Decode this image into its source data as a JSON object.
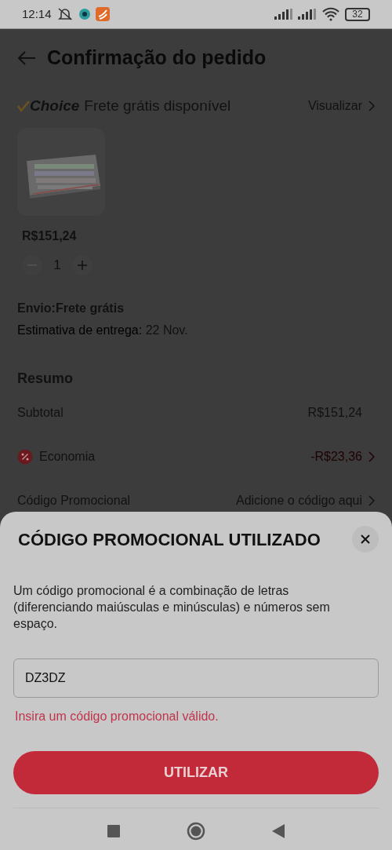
{
  "status_bar": {
    "time": "12:14",
    "battery": "32"
  },
  "header": {
    "title": "Confirmação do pedido"
  },
  "shipping_banner": {
    "brand": "Choice",
    "text": "Frete grátis disponível",
    "link": "Visualizar"
  },
  "product": {
    "price": "R$151,24",
    "quantity": "1",
    "decrease_disabled": true
  },
  "delivery": {
    "shipping": "Envio:Frete grátis",
    "estimate_label": "Estimativa de entrega:",
    "estimate_date": "22 Nov."
  },
  "summary": {
    "title": "Resumo",
    "rows": [
      {
        "kind": "plain",
        "label": "Subtotal",
        "value": "R$151,24"
      },
      {
        "kind": "discount",
        "label": "Economia",
        "value": "-R$23,36"
      },
      {
        "kind": "link",
        "label": "Código Promocional",
        "value": "Adicione o código aqui"
      }
    ]
  },
  "promo_sheet": {
    "title": "CÓDIGO PROMOCIONAL UTILIZADO",
    "description": "Um código promocional é a combinação de letras (diferenciando maiúsculas e minúsculas) e números sem espaço.",
    "field_value": "DZ3DZ",
    "error": "Insira um código promocional válido.",
    "button": "UTILIZAR"
  }
}
